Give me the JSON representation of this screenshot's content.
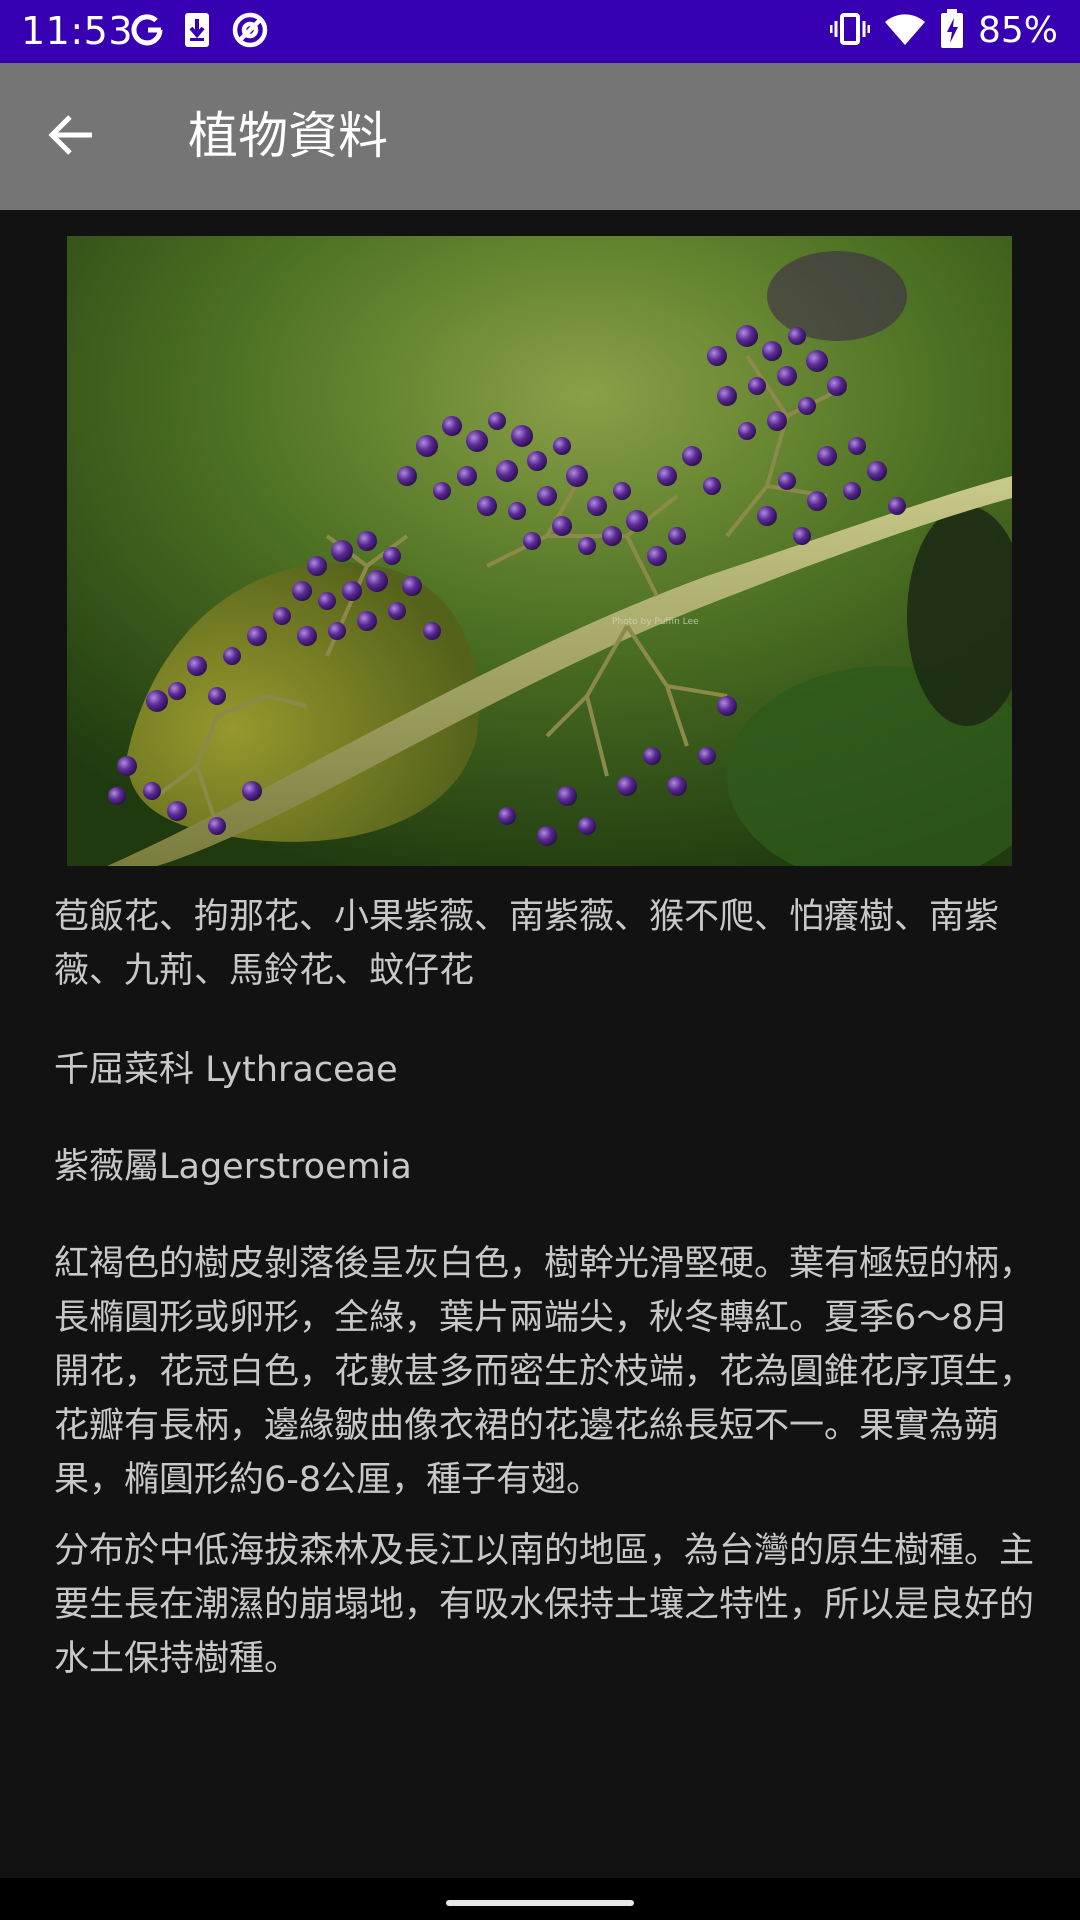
{
  "status_bar": {
    "time": "11:53",
    "left_icons": [
      "google-icon",
      "download-icon",
      "at-sign-icon"
    ],
    "right_icons": [
      "vibrate-icon",
      "wifi-icon",
      "battery-charging-icon"
    ],
    "battery_text": "85%",
    "background_color": "#3700b3"
  },
  "toolbar": {
    "title": "植物資料",
    "back_icon": "arrow-left-icon",
    "background_color": "#757575"
  },
  "content": {
    "image": {
      "watermark": "Photo by Puffin Lee"
    },
    "common_names": "苞飯花、拘那花、小果紫薇、南紫薇、猴不爬、怕癢樹、南紫薇、九荊、馬鈴花、蚊仔花",
    "family": "千屈菜科 Lythraceae",
    "genus": "紫薇屬Lagerstroemia",
    "description": "紅褐色的樹皮剝落後呈灰白色，樹幹光滑堅硬。葉有極短的柄，長橢圓形或卵形，全綠，葉片兩端尖，秋冬轉紅。夏季6～8月開花，花冠白色，花數甚多而密生於枝端，花為圓錐花序頂生，花瓣有長柄，邊緣皺曲像衣裙的花邊花絲長短不一。果實為蒴果，橢圓形約6-8公厘，種子有翅。",
    "distribution": "分布於中低海拔森林及長江以南的地區，為台灣的原生樹種。主要生長在潮濕的崩塌地，有吸水保持土壤之特性，所以是良好的水土保持樹種。",
    "text_color": "#c8c8c8",
    "background_color": "#121212"
  }
}
